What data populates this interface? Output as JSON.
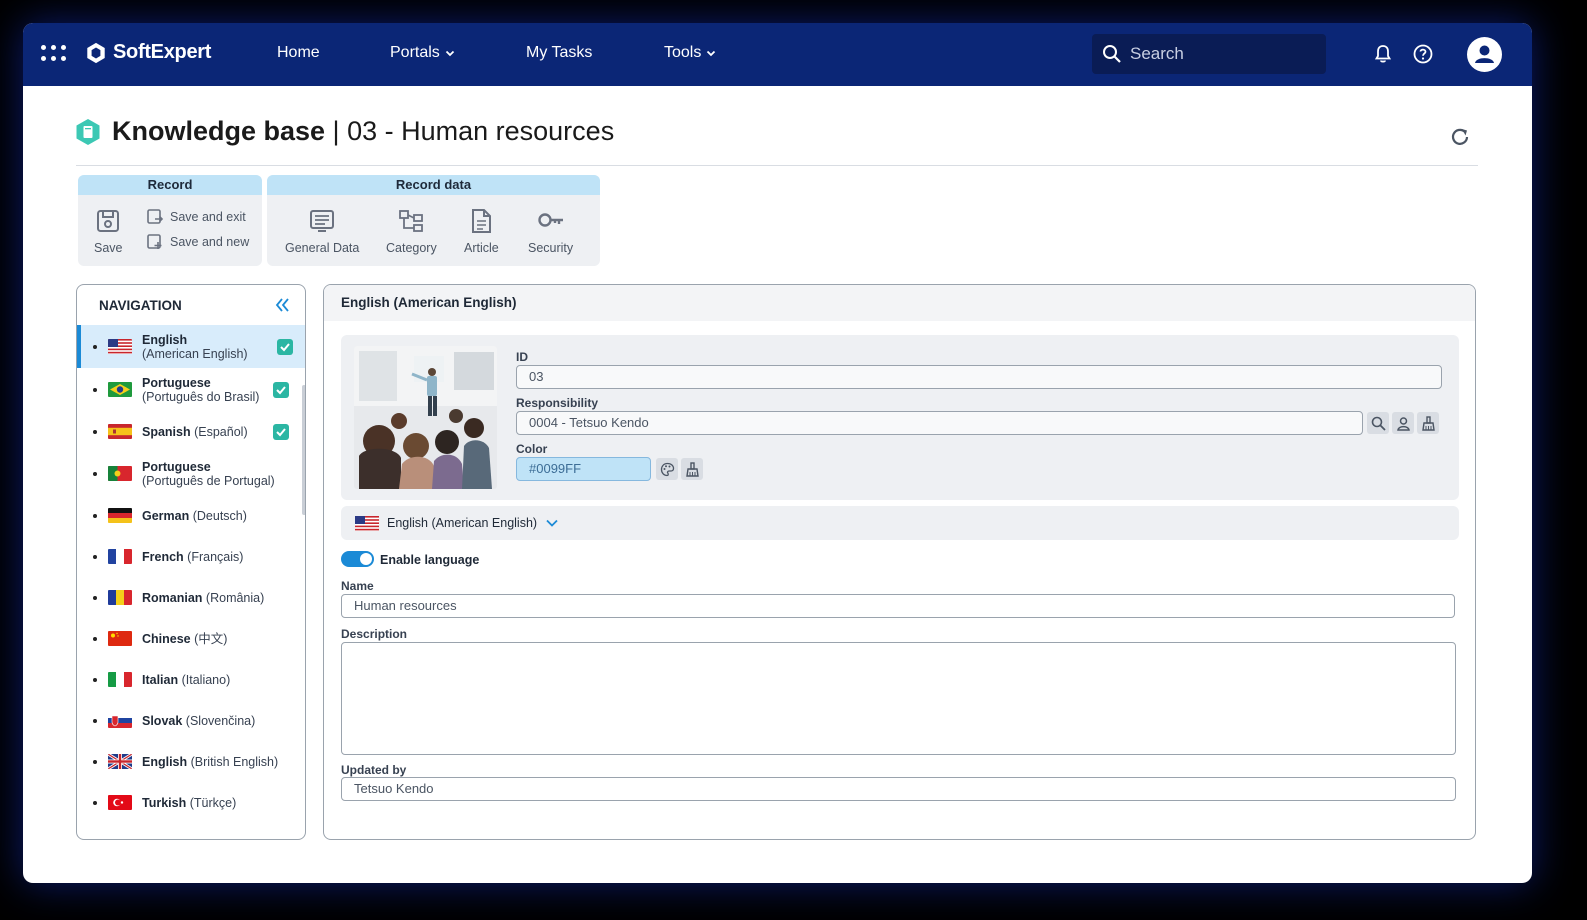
{
  "topbar": {
    "brand": "SoftExpert",
    "nav": [
      {
        "label": "Home",
        "has_dropdown": false
      },
      {
        "label": "Portals",
        "has_dropdown": true
      },
      {
        "label": "My Tasks",
        "has_dropdown": false
      },
      {
        "label": "Tools",
        "has_dropdown": true
      }
    ],
    "search_placeholder": "Search",
    "icons": [
      "apps-grid-icon",
      "bell-icon",
      "help-icon",
      "user-avatar-icon"
    ],
    "bg_color": "#0b2676"
  },
  "page": {
    "title_bold": "Knowledge base",
    "title_separator": " | ",
    "title_rest": "03 - Human resources"
  },
  "toolbar": {
    "record_group": {
      "label": "Record",
      "save": "Save",
      "save_and_exit": "Save and exit",
      "save_and_new": "Save and new"
    },
    "record_data_group": {
      "label": "Record data",
      "general_data": "General Data",
      "category": "Category",
      "article": "Article",
      "security": "Security"
    }
  },
  "navigation": {
    "title": "NAVIGATION",
    "items": [
      {
        "name": "English",
        "native": "(American English)",
        "flag": "us",
        "checked": true,
        "active": true,
        "two_line": true
      },
      {
        "name": "Portuguese",
        "native": "(Português do Brasil)",
        "flag": "br",
        "checked": true,
        "active": false,
        "two_line": true
      },
      {
        "name": "Spanish",
        "native": "(Español)",
        "flag": "es",
        "checked": true,
        "active": false,
        "two_line": false
      },
      {
        "name": "Portuguese",
        "native": "(Português de Portugal)",
        "flag": "pt",
        "checked": false,
        "active": false,
        "two_line": true
      },
      {
        "name": "German",
        "native": "(Deutsch)",
        "flag": "de",
        "checked": false,
        "active": false,
        "two_line": false
      },
      {
        "name": "French",
        "native": "(Français)",
        "flag": "fr",
        "checked": false,
        "active": false,
        "two_line": false
      },
      {
        "name": "Romanian",
        "native": "(România)",
        "flag": "ro",
        "checked": false,
        "active": false,
        "two_line": false
      },
      {
        "name": "Chinese",
        "native": "(中文)",
        "flag": "cn",
        "checked": false,
        "active": false,
        "two_line": false
      },
      {
        "name": "Italian",
        "native": "(Italiano)",
        "flag": "it",
        "checked": false,
        "active": false,
        "two_line": false
      },
      {
        "name": "Slovak",
        "native": "(Slovenčina)",
        "flag": "sk",
        "checked": false,
        "active": false,
        "two_line": false
      },
      {
        "name": "English",
        "native": "(British English)",
        "flag": "gb",
        "checked": false,
        "active": false,
        "two_line": false
      },
      {
        "name": "Turkish",
        "native": "(Türkçe)",
        "flag": "tr",
        "checked": false,
        "active": false,
        "two_line": false
      }
    ]
  },
  "main": {
    "header": "English (American English)",
    "id_label": "ID",
    "id_value": "03",
    "responsibility_label": "Responsibility",
    "responsibility_value": "0004 - Tetsuo Kendo",
    "color_label": "Color",
    "color_value": "#0099FF",
    "language_selector": "English (American English)",
    "enable_language_label": "Enable language",
    "enable_language_on": true,
    "name_label": "Name",
    "name_value": "Human resources",
    "description_label": "Description",
    "description_value": "",
    "updated_by_label": "Updated by",
    "updated_by_value": "Tetsuo Kendo"
  },
  "colors": {
    "accent": "#1b8ad6",
    "check": "#2bb6a3",
    "group_header": "#bfe3f7"
  }
}
